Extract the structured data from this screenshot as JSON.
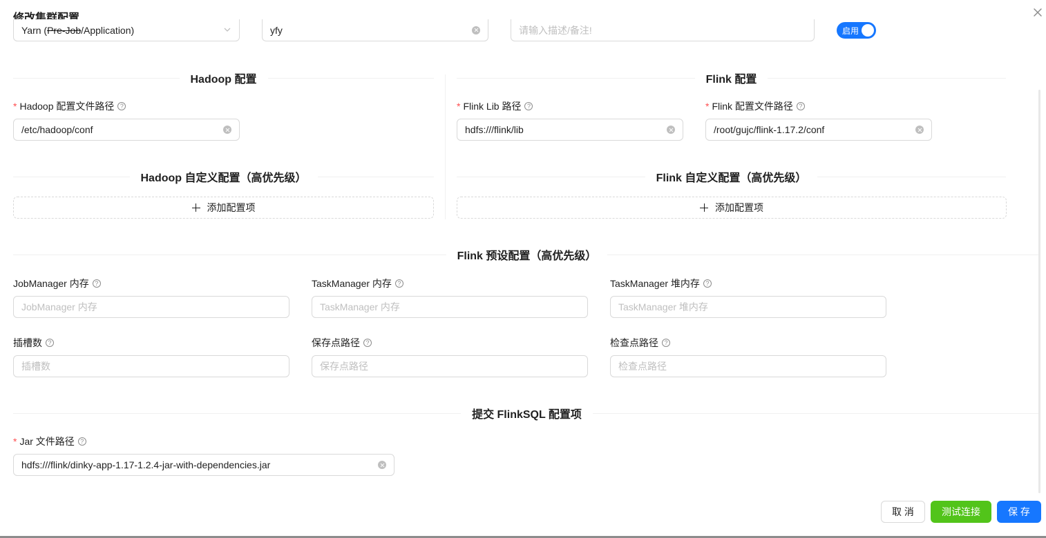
{
  "modal": {
    "title": "修改集群配置",
    "close_icon": "close-icon"
  },
  "top_row": {
    "type_select_prefix": "Yarn (",
    "type_select_strike": "Pre-Job",
    "type_select_suffix": "/Application)",
    "name_value": "yfy",
    "note_placeholder": "请输入描述/备注!",
    "enable_switch": {
      "label": "启用",
      "checked": true
    }
  },
  "hadoop": {
    "section_title": "Hadoop 配置",
    "config_path": {
      "label": "Hadoop 配置文件路径",
      "required": true,
      "value": "/etc/hadoop/conf"
    },
    "custom_title": "Hadoop 自定义配置（高优先级）",
    "add_item_label": "添加配置项"
  },
  "flink": {
    "section_title": "Flink 配置",
    "lib_path": {
      "label": "Flink Lib 路径",
      "required": true,
      "value": "hdfs:///flink/lib"
    },
    "config_path": {
      "label": "Flink 配置文件路径",
      "required": true,
      "value": "/root/gujc/flink-1.17.2/conf"
    },
    "custom_title": "Flink 自定义配置（高优先级）",
    "add_item_label": "添加配置项"
  },
  "preset": {
    "section_title": "Flink 预设配置（高优先级）",
    "fields": [
      {
        "label": "JobManager 内存",
        "placeholder": "JobManager 内存"
      },
      {
        "label": "TaskManager 内存",
        "placeholder": "TaskManager 内存"
      },
      {
        "label": "TaskManager 堆内存",
        "placeholder": "TaskManager 堆内存"
      },
      {
        "label": "插槽数",
        "placeholder": "插槽数"
      },
      {
        "label": "保存点路径",
        "placeholder": "保存点路径"
      },
      {
        "label": "检查点路径",
        "placeholder": "检查点路径"
      }
    ]
  },
  "submit": {
    "section_title": "提交 FlinkSQL 配置项",
    "jar_path": {
      "label": "Jar 文件路径",
      "required": true,
      "value": "hdfs:///flink/dinky-app-1.17-1.2.4-jar-with-dependencies.jar"
    }
  },
  "footer": {
    "cancel_label": "取 消",
    "test_label": "测试连接",
    "save_label": "保 存"
  },
  "colors": {
    "primary": "#1677ff",
    "success": "#52c41a",
    "required": "#ff4d4f",
    "border": "#d9d9d9"
  }
}
